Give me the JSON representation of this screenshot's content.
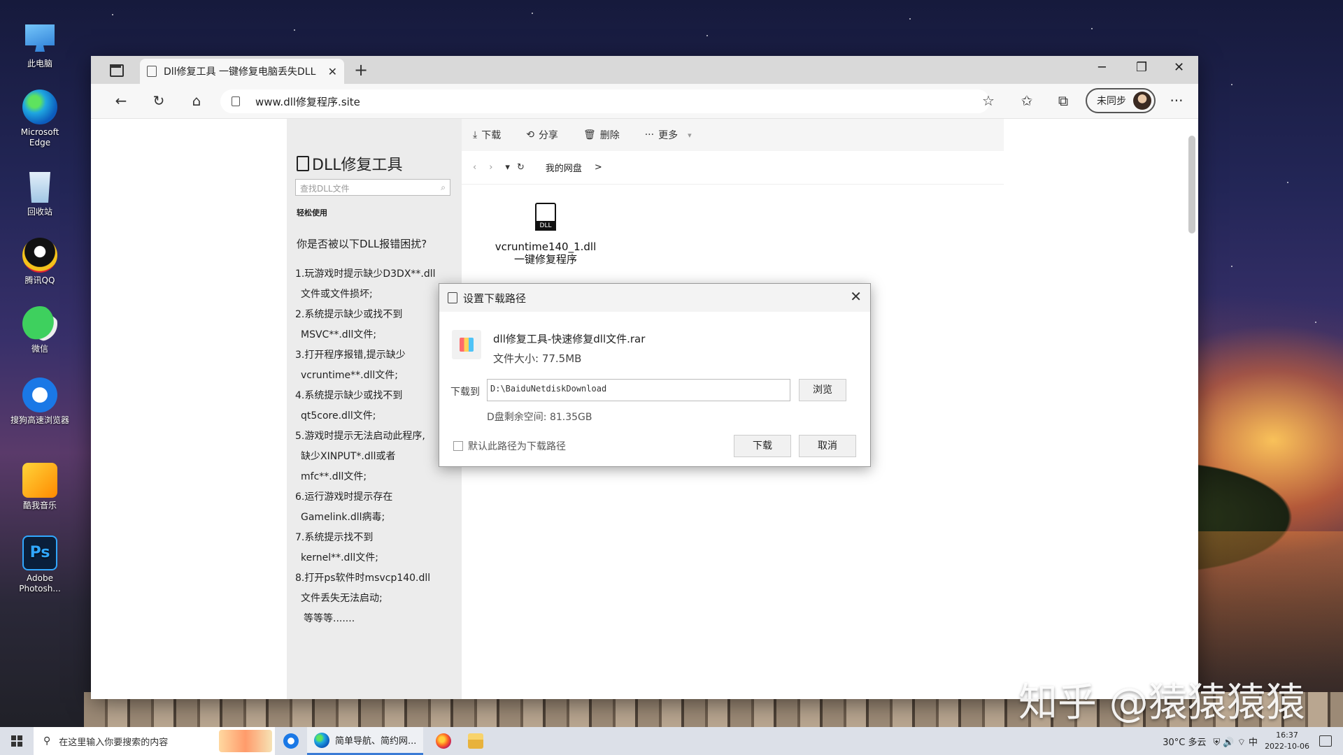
{
  "desktop": {
    "icons": [
      {
        "label": "此电脑",
        "icon": "computer-icon"
      },
      {
        "label": "Microsoft Edge",
        "icon": "edge-icon"
      },
      {
        "label": "回收站",
        "icon": "recycle-bin-icon"
      },
      {
        "label": "腾讯QQ",
        "icon": "qq-icon"
      },
      {
        "label": "微信",
        "icon": "wechat-icon"
      },
      {
        "label": "搜狗高速浏览器",
        "icon": "sogou-browser-icon"
      },
      {
        "label": "酷我音乐",
        "icon": "kuwo-music-icon"
      },
      {
        "label": "Adobe Photosh...",
        "icon": "photoshop-icon"
      }
    ],
    "ps_glyph": "Ps"
  },
  "browser": {
    "tab_title": "Dll修复工具 一键修复电脑丢失DLL",
    "tab_close": "✕",
    "new_tab": "+",
    "window_controls": {
      "minimize": "─",
      "maximize": "❐",
      "close": "✕"
    },
    "nav": {
      "back": "←",
      "refresh": "↻",
      "home": "⌂"
    },
    "url": "www.dll修复程序.site",
    "toolbar_icons": {
      "favorite": "☆",
      "favorites": "✩",
      "collections": "⧉",
      "more": "···"
    },
    "profile_label": "未同步"
  },
  "left_panel": {
    "title": "DLL修复工具",
    "search_placeholder": "查找DLL文件",
    "search_icon": "⌕",
    "easy_use": "轻松使用",
    "question": "你是否被以下DLL报错困扰?",
    "items": [
      "1.玩游戏时提示缺少D3DX**.dll",
      "文件或文件损坏;",
      "2.系统提示缺少或找不到",
      "MSVC**.dll文件;",
      "3.打开程序报错,提示缺少",
      "vcruntime**.dll文件;",
      "4.系统提示缺少或找不到",
      "qt5core.dll文件;",
      "5.游戏时提示无法启动此程序,",
      "缺少XINPUT*.dll或者",
      "mfc**.dll文件;",
      "6.运行游戏时提示存在",
      "Gamelink.dll病毒;",
      "7.系统提示找不到",
      "kernel**.dll文件;",
      "8.打开ps软件时msvcp140.dll",
      "文件丢失无法启动;",
      "等等等......."
    ]
  },
  "file_area": {
    "toolbar": [
      {
        "icon": "⤓",
        "label": "下载"
      },
      {
        "icon": "⟲",
        "label": "分享"
      },
      {
        "icon": "🗑",
        "label": "删除"
      },
      {
        "icon": "···",
        "label": "更多"
      }
    ],
    "more_caret": "▾",
    "nav": {
      "back": "‹",
      "forward": "›",
      "dropdown": "▾",
      "refresh": "↻",
      "breadcrumb": "我的网盘",
      "crumb_sep": ">"
    },
    "file": {
      "name_line1": "vcruntime140_1.dll",
      "name_line2": "一键修复程序"
    }
  },
  "dialog": {
    "title": "设置下载路径",
    "close": "✕",
    "file_name": "dll修复工具-快速修复dll文件.rar",
    "file_size": "文件大小: 77.5MB",
    "download_to_label": "下载到",
    "path_value": "D:\\BaiduNetdiskDownload",
    "browse_button": "浏览",
    "free_space": "D盘剩余空间: 81.35GB",
    "default_path_label": "默认此路径为下载路径",
    "default_path_checked": false,
    "download_button": "下载",
    "cancel_button": "取消"
  },
  "watermark": "知乎 @猿猿猿猿",
  "taskbar": {
    "search_placeholder": "在这里输入你要搜索的内容",
    "search_icon": "⚲",
    "edge_app_label": "简单导航、简约网...",
    "weather": "30°C 多云",
    "tray_icons": "⛨ 🔊 ⌔ 中",
    "time": "16:37",
    "date": "2022-10-06"
  }
}
